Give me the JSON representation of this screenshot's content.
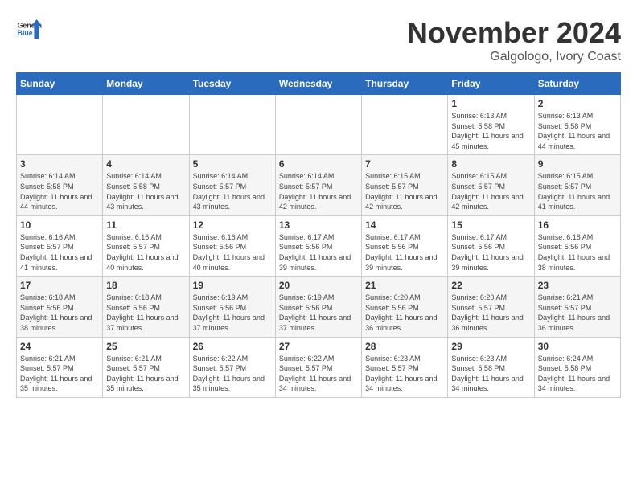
{
  "header": {
    "logo_general": "General",
    "logo_blue": "Blue",
    "month_title": "November 2024",
    "location": "Galgologo, Ivory Coast"
  },
  "weekdays": [
    "Sunday",
    "Monday",
    "Tuesday",
    "Wednesday",
    "Thursday",
    "Friday",
    "Saturday"
  ],
  "weeks": [
    [
      {
        "day": "",
        "info": ""
      },
      {
        "day": "",
        "info": ""
      },
      {
        "day": "",
        "info": ""
      },
      {
        "day": "",
        "info": ""
      },
      {
        "day": "",
        "info": ""
      },
      {
        "day": "1",
        "info": "Sunrise: 6:13 AM\nSunset: 5:58 PM\nDaylight: 11 hours and 45 minutes."
      },
      {
        "day": "2",
        "info": "Sunrise: 6:13 AM\nSunset: 5:58 PM\nDaylight: 11 hours and 44 minutes."
      }
    ],
    [
      {
        "day": "3",
        "info": "Sunrise: 6:14 AM\nSunset: 5:58 PM\nDaylight: 11 hours and 44 minutes."
      },
      {
        "day": "4",
        "info": "Sunrise: 6:14 AM\nSunset: 5:58 PM\nDaylight: 11 hours and 43 minutes."
      },
      {
        "day": "5",
        "info": "Sunrise: 6:14 AM\nSunset: 5:57 PM\nDaylight: 11 hours and 43 minutes."
      },
      {
        "day": "6",
        "info": "Sunrise: 6:14 AM\nSunset: 5:57 PM\nDaylight: 11 hours and 42 minutes."
      },
      {
        "day": "7",
        "info": "Sunrise: 6:15 AM\nSunset: 5:57 PM\nDaylight: 11 hours and 42 minutes."
      },
      {
        "day": "8",
        "info": "Sunrise: 6:15 AM\nSunset: 5:57 PM\nDaylight: 11 hours and 42 minutes."
      },
      {
        "day": "9",
        "info": "Sunrise: 6:15 AM\nSunset: 5:57 PM\nDaylight: 11 hours and 41 minutes."
      }
    ],
    [
      {
        "day": "10",
        "info": "Sunrise: 6:16 AM\nSunset: 5:57 PM\nDaylight: 11 hours and 41 minutes."
      },
      {
        "day": "11",
        "info": "Sunrise: 6:16 AM\nSunset: 5:57 PM\nDaylight: 11 hours and 40 minutes."
      },
      {
        "day": "12",
        "info": "Sunrise: 6:16 AM\nSunset: 5:56 PM\nDaylight: 11 hours and 40 minutes."
      },
      {
        "day": "13",
        "info": "Sunrise: 6:17 AM\nSunset: 5:56 PM\nDaylight: 11 hours and 39 minutes."
      },
      {
        "day": "14",
        "info": "Sunrise: 6:17 AM\nSunset: 5:56 PM\nDaylight: 11 hours and 39 minutes."
      },
      {
        "day": "15",
        "info": "Sunrise: 6:17 AM\nSunset: 5:56 PM\nDaylight: 11 hours and 39 minutes."
      },
      {
        "day": "16",
        "info": "Sunrise: 6:18 AM\nSunset: 5:56 PM\nDaylight: 11 hours and 38 minutes."
      }
    ],
    [
      {
        "day": "17",
        "info": "Sunrise: 6:18 AM\nSunset: 5:56 PM\nDaylight: 11 hours and 38 minutes."
      },
      {
        "day": "18",
        "info": "Sunrise: 6:18 AM\nSunset: 5:56 PM\nDaylight: 11 hours and 37 minutes."
      },
      {
        "day": "19",
        "info": "Sunrise: 6:19 AM\nSunset: 5:56 PM\nDaylight: 11 hours and 37 minutes."
      },
      {
        "day": "20",
        "info": "Sunrise: 6:19 AM\nSunset: 5:56 PM\nDaylight: 11 hours and 37 minutes."
      },
      {
        "day": "21",
        "info": "Sunrise: 6:20 AM\nSunset: 5:56 PM\nDaylight: 11 hours and 36 minutes."
      },
      {
        "day": "22",
        "info": "Sunrise: 6:20 AM\nSunset: 5:57 PM\nDaylight: 11 hours and 36 minutes."
      },
      {
        "day": "23",
        "info": "Sunrise: 6:21 AM\nSunset: 5:57 PM\nDaylight: 11 hours and 36 minutes."
      }
    ],
    [
      {
        "day": "24",
        "info": "Sunrise: 6:21 AM\nSunset: 5:57 PM\nDaylight: 11 hours and 35 minutes."
      },
      {
        "day": "25",
        "info": "Sunrise: 6:21 AM\nSunset: 5:57 PM\nDaylight: 11 hours and 35 minutes."
      },
      {
        "day": "26",
        "info": "Sunrise: 6:22 AM\nSunset: 5:57 PM\nDaylight: 11 hours and 35 minutes."
      },
      {
        "day": "27",
        "info": "Sunrise: 6:22 AM\nSunset: 5:57 PM\nDaylight: 11 hours and 34 minutes."
      },
      {
        "day": "28",
        "info": "Sunrise: 6:23 AM\nSunset: 5:57 PM\nDaylight: 11 hours and 34 minutes."
      },
      {
        "day": "29",
        "info": "Sunrise: 6:23 AM\nSunset: 5:58 PM\nDaylight: 11 hours and 34 minutes."
      },
      {
        "day": "30",
        "info": "Sunrise: 6:24 AM\nSunset: 5:58 PM\nDaylight: 11 hours and 34 minutes."
      }
    ]
  ]
}
